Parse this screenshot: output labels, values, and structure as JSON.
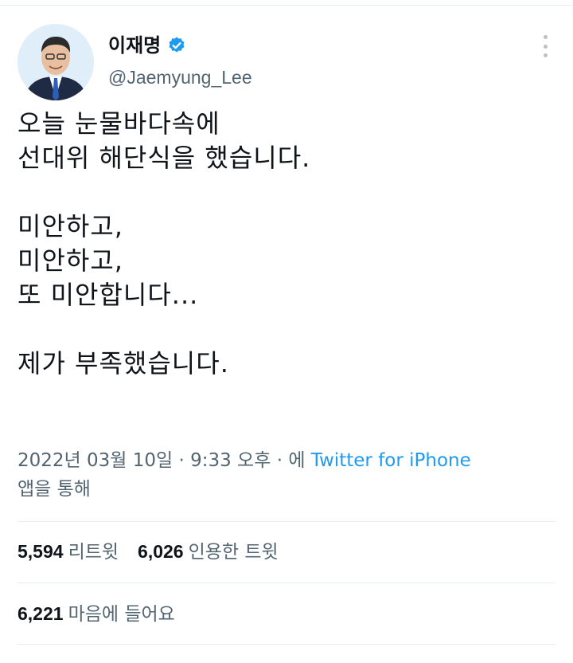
{
  "author": {
    "display_name": "이재명",
    "handle": "@Jaemyung_Lee"
  },
  "tweet": {
    "lines": [
      "오늘 눈물바다속에",
      "선대위 해단식을 했습니다.",
      "",
      "미안하고,",
      "미안하고,",
      "또 미안합니다...",
      "",
      "제가 부족했습니다."
    ]
  },
  "meta": {
    "timestamp": "2022년 03월 10일 · 9:33 오후 · 에",
    "source": "Twitter for iPhone",
    "suffix": "앱을 통해"
  },
  "stats": {
    "retweets_count": "5,594",
    "retweets_label": "리트윗",
    "quotes_count": "6,026",
    "quotes_label": "인용한 트윗",
    "likes_count": "6,221",
    "likes_label": "마음에 들어요"
  },
  "colors": {
    "link": "#1d9bf0",
    "verified": "#1d9bf0",
    "secondary_text": "#536471"
  },
  "icons": [
    "verified-badge-icon",
    "more-options-icon"
  ]
}
